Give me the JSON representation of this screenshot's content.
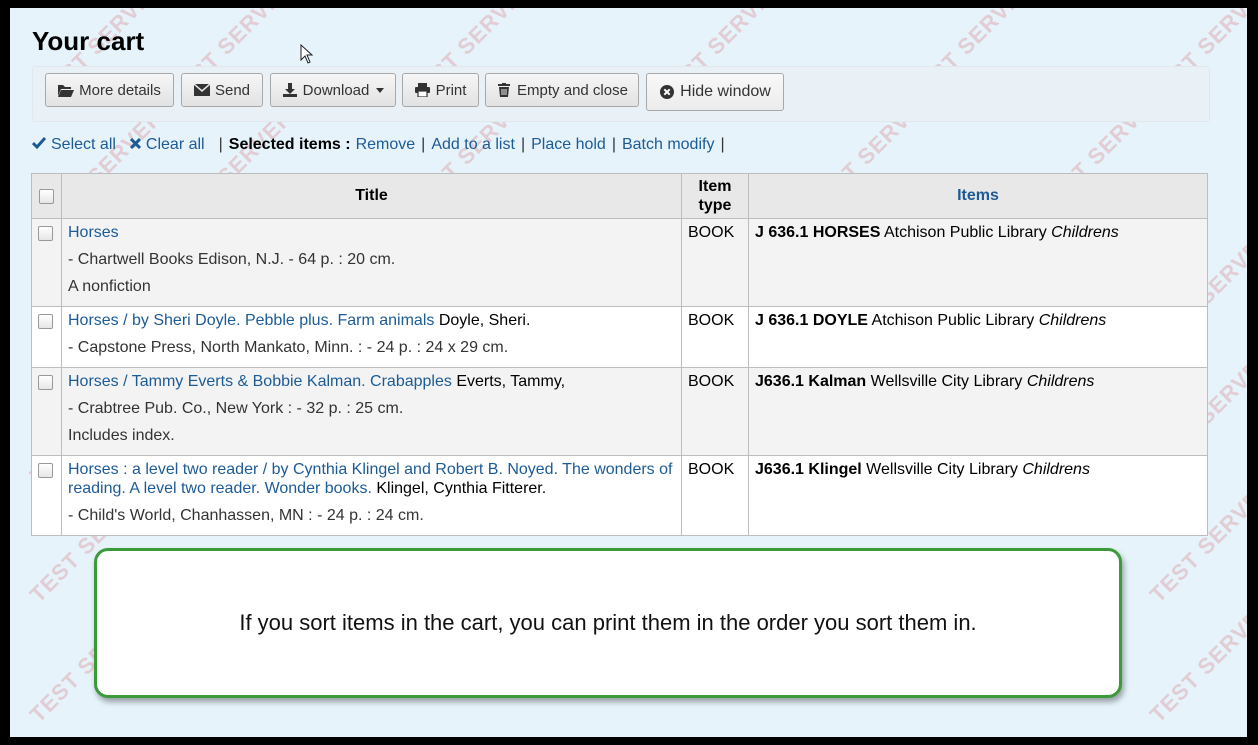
{
  "page": {
    "title": "Your cart",
    "watermark": "TEST SERVER"
  },
  "toolbar": {
    "more_details": "More details",
    "send": "Send",
    "download": "Download",
    "print": "Print",
    "empty_close": "Empty and close",
    "hide_window": "Hide window"
  },
  "selection": {
    "select_all": "Select all",
    "clear_all": "Clear all",
    "selected_items": "Selected items :",
    "remove": "Remove",
    "add_to_list": "Add to a list",
    "place_hold": "Place hold",
    "batch_modify": "Batch modify"
  },
  "table": {
    "headers": {
      "title": "Title",
      "item_type_1": "Item",
      "item_type_2": "type",
      "items": "Items"
    },
    "rows": [
      {
        "title_link": "Horses",
        "author": "",
        "pub": "- Chartwell Books Edison, N.J. - 64 p. : 20 cm.",
        "note": "A nonfiction",
        "item_type": "BOOK",
        "callnumber": "J 636.1 HORSES",
        "library": "Atchison Public Library",
        "collection": "Childrens"
      },
      {
        "title_link": "Horses / by Sheri Doyle. Pebble plus. Farm animals",
        "author": "Doyle, Sheri.",
        "pub": "- Capstone Press, North Mankato, Minn. : - 24 p. : 24 x 29 cm.",
        "note": "",
        "item_type": "BOOK",
        "callnumber": "J 636.1 DOYLE",
        "library": "Atchison Public Library",
        "collection": "Childrens"
      },
      {
        "title_link": "Horses / Tammy Everts & Bobbie Kalman. Crabapples",
        "author": "Everts, Tammy,",
        "pub": "- Crabtree Pub. Co., New York : - 32 p. : 25 cm.",
        "note": "Includes index.",
        "item_type": "BOOK",
        "callnumber": "J636.1 Kalman",
        "library": "Wellsville City Library",
        "collection": "Childrens"
      },
      {
        "title_link": "Horses : a level two reader / by Cynthia Klingel and Robert B. Noyed. The wonders of reading. A level two reader. Wonder books.",
        "author": "Klingel, Cynthia Fitterer.",
        "pub": "- Child's World, Chanhassen, MN : - 24 p. : 24 cm.",
        "note": "",
        "item_type": "BOOK",
        "callnumber": "J636.1 Klingel",
        "library": "Wellsville City Library",
        "collection": "Childrens"
      }
    ]
  },
  "callout": {
    "text": "If you sort items in the cart, you can print them in the order you sort them in."
  },
  "colors": {
    "link": "#1d5b95",
    "callout_border": "#3b9b3b",
    "background": "#e6f3fb"
  }
}
